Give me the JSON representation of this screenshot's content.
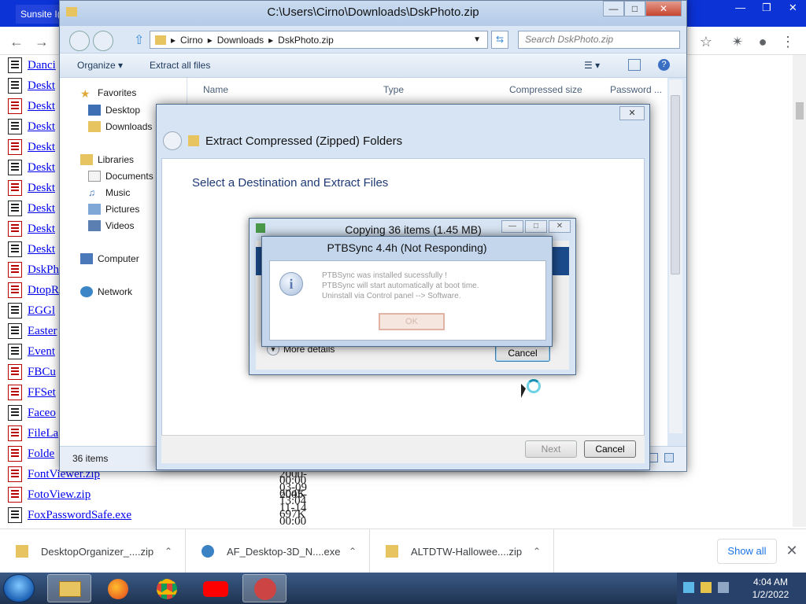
{
  "browser": {
    "tab_fragment": "Sunsite I(",
    "files": [
      {
        "name": "Danci",
        "icon": "doc-icon",
        "red": false
      },
      {
        "name": "Deskt",
        "icon": "doc-icon",
        "red": false
      },
      {
        "name": "Deskt",
        "icon": "exe-icon",
        "red": true
      },
      {
        "name": "Deskt",
        "icon": "doc-icon",
        "red": false
      },
      {
        "name": "Deskt",
        "icon": "exe-icon",
        "red": true
      },
      {
        "name": "Deskt",
        "icon": "doc-icon",
        "red": false
      },
      {
        "name": "Deskt",
        "icon": "exe-icon",
        "red": true
      },
      {
        "name": "Deskt",
        "icon": "doc-icon",
        "red": false
      },
      {
        "name": "Deskt",
        "icon": "exe-icon",
        "red": true
      },
      {
        "name": "Deskt",
        "icon": "doc-icon",
        "red": false
      },
      {
        "name": "DskPh",
        "icon": "exe-icon",
        "red": true
      },
      {
        "name": "DtopR",
        "icon": "exe-icon",
        "red": true
      },
      {
        "name": "EGGl",
        "icon": "doc-icon",
        "red": false
      },
      {
        "name": "Easter",
        "icon": "doc-icon",
        "red": false
      },
      {
        "name": "Event",
        "icon": "doc-icon",
        "red": false
      },
      {
        "name": "FBCu",
        "icon": "exe-icon",
        "red": true
      },
      {
        "name": "FFSet",
        "icon": "exe-icon",
        "red": true
      },
      {
        "name": "Faceo",
        "icon": "doc-icon",
        "red": false
      },
      {
        "name": "FileLa",
        "icon": "exe-icon",
        "red": true
      },
      {
        "name": "Folde",
        "icon": "exe-icon",
        "red": true
      },
      {
        "name": "FontViewer.zip",
        "icon": "exe-icon",
        "red": true,
        "meta": "2005-07-22 00:00 604K"
      },
      {
        "name": "FotoView.zip",
        "icon": "exe-icon",
        "red": true,
        "meta": "2000-03-09 13:04 697K"
      },
      {
        "name": "FoxPasswordSafe.exe",
        "icon": "doc-icon",
        "red": false,
        "meta": "2005-11-14 00:00 928K"
      }
    ],
    "downloads": [
      {
        "name": "DesktopOrganizer_....zip"
      },
      {
        "name": "AF_Desktop-3D_N....exe"
      },
      {
        "name": "ALTDTW-Hallowee....zip"
      }
    ],
    "show_all": "Show all"
  },
  "explorer": {
    "title": "C:\\Users\\Cirno\\Downloads\\DskPhoto.zip",
    "breadcrumbs": [
      "Cirno",
      "Downloads",
      "DskPhoto.zip"
    ],
    "search_placeholder": "Search DskPhoto.zip",
    "commands": {
      "organize": "Organize ▾",
      "extract": "Extract all files"
    },
    "nav": {
      "favorites": "Favorites",
      "desktop": "Desktop",
      "downloads": "Downloads",
      "libraries": "Libraries",
      "documents": "Documents",
      "music": "Music",
      "pictures": "Pictures",
      "videos": "Videos",
      "computer": "Computer",
      "network": "Network"
    },
    "columns": {
      "name": "Name",
      "type": "Type",
      "compressed": "Compressed size",
      "password": "Password ..."
    },
    "status": "36 items"
  },
  "wizard": {
    "title": "Extract Compressed (Zipped) Folders",
    "heading": "Select a Destination and Extract Files",
    "next": "Next",
    "cancel": "Cancel"
  },
  "copying": {
    "title": "Copying 36 items (1.45 MB)",
    "more_details": "More details",
    "cancel": "Cancel"
  },
  "ptbsync": {
    "title": "PTBSync 4.4h (Not Responding)",
    "line1": "PTBSync was installed sucessfully !",
    "line2": "PTBSync will start automatically at boot time.",
    "line3": "Uninstall via Control panel --> Software.",
    "ok": "OK"
  },
  "taskbar": {
    "time": "4:04 AM",
    "date": "1/2/2022"
  }
}
